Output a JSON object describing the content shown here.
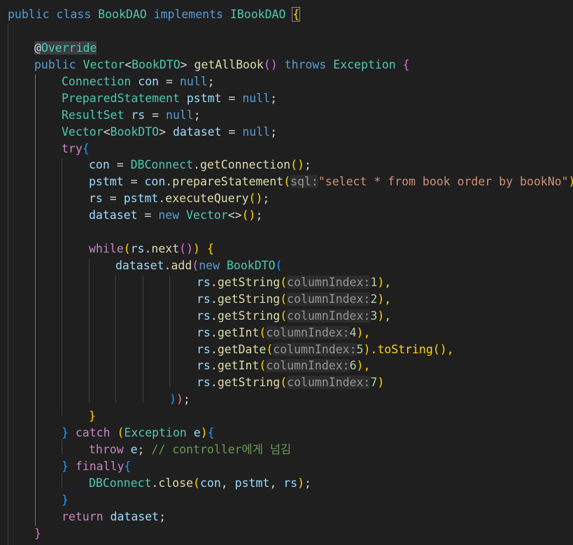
{
  "editor": {
    "class_decl": {
      "kw_public": "public",
      "kw_class": "class",
      "class_name": "BookDAO",
      "kw_implements": "implements",
      "iface": "IBookDAO",
      "brace": "{"
    },
    "annotation": {
      "at": "@",
      "name": "Override"
    },
    "method_decl": {
      "kw_public": "public",
      "ret_type": "Vector",
      "generic_open": "<",
      "generic_type": "BookDTO",
      "generic_close": ">",
      "name": "getAllBook",
      "parens": "()",
      "kw_throws": "throws",
      "exception": "Exception",
      "brace": "{"
    },
    "decls": [
      {
        "type": "Connection",
        "name": "con",
        "eq": "=",
        "val": "null",
        "semi": ";"
      },
      {
        "type": "PreparedStatement",
        "name": "pstmt",
        "eq": "=",
        "val": "null",
        "semi": ";"
      },
      {
        "type": "ResultSet",
        "name": "rs",
        "eq": "=",
        "val": "null",
        "semi": ";"
      },
      {
        "type": "Vector",
        "generic": "BookDTO",
        "name": "dataset",
        "eq": "=",
        "val": "null",
        "semi": ";"
      }
    ],
    "try_kw": "try",
    "try_body": {
      "l1_var": "con",
      "l1_cls": "DBConnect",
      "l1_fn": "getConnection",
      "l2_var": "pstmt",
      "l2_obj": "con",
      "l2_fn": "prepareStatement",
      "l2_hint": "sql:",
      "l2_str": "\"select * from book order by bookNo\"",
      "l3_var": "rs",
      "l3_obj": "pstmt",
      "l3_fn": "executeQuery",
      "l4_var": "dataset",
      "l4_new": "new",
      "l4_type": "Vector",
      "l4_diamond": "<>"
    },
    "while_kw": "while",
    "while_cond_obj": "rs",
    "while_cond_fn": "next",
    "add_obj": "dataset",
    "add_fn": "add",
    "new_kw": "new",
    "dto": "BookDTO",
    "getters": [
      {
        "fn": "getString",
        "hint": "columnIndex:",
        "idx": "1",
        "tail": "),"
      },
      {
        "fn": "getString",
        "hint": "columnIndex:",
        "idx": "2",
        "tail": "),"
      },
      {
        "fn": "getString",
        "hint": "columnIndex:",
        "idx": "3",
        "tail": "),"
      },
      {
        "fn": "getInt",
        "hint": "columnIndex:",
        "idx": "4",
        "tail": "),"
      },
      {
        "fn": "getDate",
        "hint": "columnIndex:",
        "idx": "5",
        "tail": ").toString(),"
      },
      {
        "fn": "getInt",
        "hint": "columnIndex:",
        "idx": "6",
        "tail": "),"
      },
      {
        "fn": "getString",
        "hint": "columnIndex:",
        "idx": "7",
        "tail": ")"
      }
    ],
    "getter_obj": "rs",
    "catch_kw": "catch",
    "catch_type": "Exception",
    "catch_var": "e",
    "throw_kw": "throw",
    "throw_var": "e",
    "comment": "// controller에게 넘김",
    "finally_kw": "finally",
    "close_cls": "DBConnect",
    "close_fn": "close",
    "close_args": [
      "con",
      "pstmt",
      "rs"
    ],
    "return_kw": "return",
    "return_var": "dataset"
  }
}
